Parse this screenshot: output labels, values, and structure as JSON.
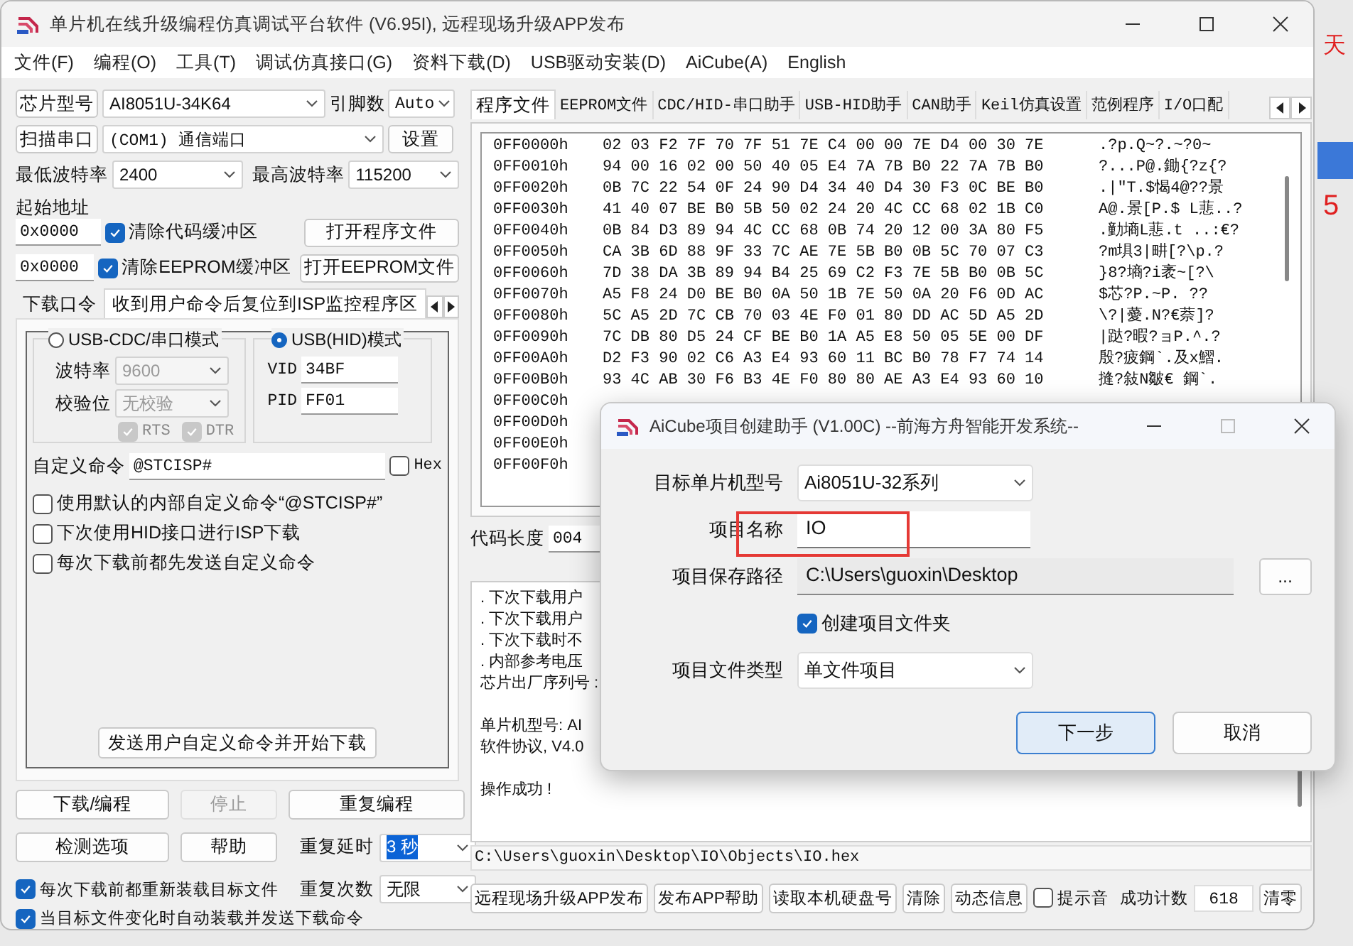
{
  "window": {
    "title": "单片机在线升级编程仿真调试平台软件 (V6.95I), 远程现场升级APP发布"
  },
  "menu": [
    "文件(F)",
    "编程(O)",
    "工具(T)",
    "调试仿真接口(G)",
    "资料下载(D)",
    "USB驱动安装(D)",
    "AiCube(A)",
    "English"
  ],
  "chip": {
    "button": "芯片型号",
    "value": "AI8051U-34K64",
    "pins_label": "引脚数",
    "pins_value": "Auto"
  },
  "port": {
    "button": "扫描串口",
    "value": "(COM1) 通信端口",
    "settings_button": "设置"
  },
  "baud": {
    "min_label": "最低波特率",
    "min_value": "2400",
    "max_label": "最高波特率",
    "max_value": "115200"
  },
  "start_address": {
    "label": "起始地址",
    "rows": [
      {
        "address": "0x0000",
        "checkbox": "清除代码缓冲区",
        "checked": true,
        "button": "打开程序文件"
      },
      {
        "address": "0x0000",
        "checkbox": "清除EEPROM缓冲区",
        "checked": true,
        "button": "打开EEPROM文件"
      }
    ]
  },
  "left_tabs": [
    {
      "label": "下载口令",
      "selected": false
    },
    {
      "label": "收到用户命令后复位到ISP监控程序区",
      "selected": true
    }
  ],
  "serial_mode": {
    "label": "USB-CDC/串口模式",
    "selected": false,
    "baud_label": "波特率",
    "baud_value": "9600",
    "parity_label": "校验位",
    "parity_value": "无校验",
    "disabled": true,
    "flags": [
      {
        "label": "RTS",
        "checked": true
      },
      {
        "label": "DTR",
        "checked": true
      }
    ]
  },
  "hid_mode": {
    "label": "USB(HID)模式",
    "selected": true,
    "vid_label": "VID",
    "vid": "34BF",
    "pid_label": "PID",
    "pid": "FF01"
  },
  "custom_command": {
    "label": "自定义命令",
    "value": "@STCISP#",
    "hex_label": "Hex",
    "hex_checked": false
  },
  "options": [
    {
      "label": "使用默认的内部自定义命令“@STCISP#”",
      "checked": false
    },
    {
      "label": "下次使用HID接口进行ISP下载",
      "checked": false
    },
    {
      "label": "每次下载前都先发送自定义命令",
      "checked": false
    }
  ],
  "send_button": "发送用户自定义命令并开始下载",
  "actions": [
    {
      "label": "下载/编程",
      "disabled": false
    },
    {
      "label": "停止",
      "disabled": true
    },
    {
      "label": "重复编程",
      "disabled": false
    },
    {
      "label": "检测选项",
      "disabled": false
    },
    {
      "label": "帮助",
      "disabled": false
    }
  ],
  "repeat": [
    {
      "label": "重复延时",
      "value": "3 秒",
      "highlighted": true
    },
    {
      "label": "重复次数",
      "value": "无限",
      "highlighted": false
    }
  ],
  "reload_options": [
    {
      "label": "每次下载前都重新装载目标文件",
      "checked": true
    },
    {
      "label": "当目标文件变化时自动装载并发送下载命令",
      "checked": true
    }
  ],
  "right_tabs": [
    {
      "label": "程序文件",
      "selected": true
    },
    {
      "label": "EEPROM文件",
      "selected": false
    },
    {
      "label": "CDC/HID-串口助手",
      "selected": false
    },
    {
      "label": "USB-HID助手",
      "selected": false
    },
    {
      "label": "CAN助手",
      "selected": false
    },
    {
      "label": "Keil仿真设置",
      "selected": false
    },
    {
      "label": "范例程序",
      "selected": false
    },
    {
      "label": "I/O口配",
      "selected": false
    }
  ],
  "hex": {
    "rows": [
      {
        "address": "0FF0000h",
        "bytes": "02 03 F2 7F 70 7F 51 7E C4 00 00 7E D4 00 30 7E",
        "ascii": ".?p.Q~?.~?0~"
      },
      {
        "address": "0FF0010h",
        "bytes": "94 00 16 02 00 50 40 05 E4 7A 7B B0 22 7A 7B B0",
        "ascii": "?...P@.鋤{?z{?"
      },
      {
        "address": "0FF0020h",
        "bytes": "0B 7C 22 54 0F 24 90 D4 34 40 D4 30 F3 0C BE B0",
        "ascii": ".|\"T.$愒4@??景"
      },
      {
        "address": "0FF0030h",
        "bytes": "41 40 07 BE B0 5B 50 02 24 20 4C CC 68 02 1B C0",
        "ascii": "A@.景[P.$ L蕜..?"
      },
      {
        "address": "0FF0040h",
        "bytes": "0B 84 D3 89 94 4C CC 68 0B 74 20 12 00 3A 80 F5",
        "ascii": ".勭墒L蕜.t ..:€?"
      },
      {
        "address": "0FF0050h",
        "bytes": "CA 3B 6D 88 9F 33 7C AE 7E 5B B0 0B 5C 70 07 C3",
        "ascii": "?m埧3|畊[?\\p.?"
      },
      {
        "address": "0FF0060h",
        "bytes": "7D 38 DA 3B 89 94 B4 25 69 C2 F3 7E 5B B0 0B 5C",
        "ascii": "}8?墒?i袤~[?\\"
      },
      {
        "address": "0FF0070h",
        "bytes": "A5 F8 24 D0 BE B0 0A 50 1B 7E 50 0A 20 F6 0D AC",
        "ascii": "  $芯?P.~P. ??"
      },
      {
        "address": "0FF0080h",
        "bytes": "5C A5 2D 7C CB 70 03 4E F0 01 80 DD AC 5D A5 2D",
        "ascii": "\\?|薆.N?€萘]?"
      },
      {
        "address": "0FF0090h",
        "bytes": "7C DB 80 D5 24 CF BE B0 1A A5 E8 50 05 5E 00 DF",
        "ascii": "|跶?暇?ョP.^.?"
      },
      {
        "address": "0FF00A0h",
        "bytes": "D2 F3 90 02 C6 A3 E4 93 60 11 BC B0 78 F7 74 14",
        "ascii": "殷?疲鋼`.及x鰼."
      },
      {
        "address": "0FF00B0h",
        "bytes": "93 4C AB 30 F6 B3 4E F0 80 80 AE A3 E4 93 60 10",
        "ascii": "摓?敍N皺€  鋼`."
      },
      {
        "address": "0FF00C0h"
      },
      {
        "address": "0FF00D0h"
      },
      {
        "address": "0FF00E0h"
      },
      {
        "address": "0FF00F0h"
      }
    ]
  },
  "code_length": {
    "label": "代码长度",
    "value": "004"
  },
  "log": [
    {
      "lines": [
        ". 下次下载用户",
        ". 下次下载用户",
        ". 下次下载时不",
        ". 内部参考电压",
        "芯片出厂序列号 :"
      ]
    },
    {
      "lines": [
        "单片机型号: AI",
        "软件协议, V4.0"
      ]
    },
    {
      "lines": [
        "操作成功 !"
      ]
    }
  ],
  "file_path": "C:\\Users\\guoxin\\Desktop\\IO\\Objects\\IO.hex",
  "bottom_buttons": [
    "远程现场升级APP发布",
    "发布APP帮助",
    "读取本机硬盘号",
    "清除",
    "动态信息"
  ],
  "sound": {
    "label": "提示音",
    "checked": false
  },
  "success": {
    "label": "成功计数",
    "value": "618",
    "reset_button": "清零"
  },
  "dialog": {
    "title": "AiCube项目创建助手 (V1.00C) --前海方舟智能开发系统--",
    "fields": [
      {
        "kind": "select",
        "label": "目标单片机型号",
        "value": "Ai8051U-32系列"
      },
      {
        "kind": "input",
        "label": "项目名称",
        "value": "IO"
      },
      {
        "kind": "path",
        "label": "项目保存路径",
        "value": "C:\\Users\\guoxin\\Desktop",
        "button": "..."
      },
      {
        "kind": "checkbox",
        "label": "创建项目文件夹",
        "checked": true
      },
      {
        "kind": "select",
        "label": "项目文件类型",
        "value": "单文件项目"
      }
    ],
    "buttons": [
      {
        "label": "下一步",
        "default": true
      },
      {
        "label": "取消",
        "default": false
      }
    ]
  },
  "desktop": {
    "texts": [
      "天",
      "5"
    ]
  }
}
